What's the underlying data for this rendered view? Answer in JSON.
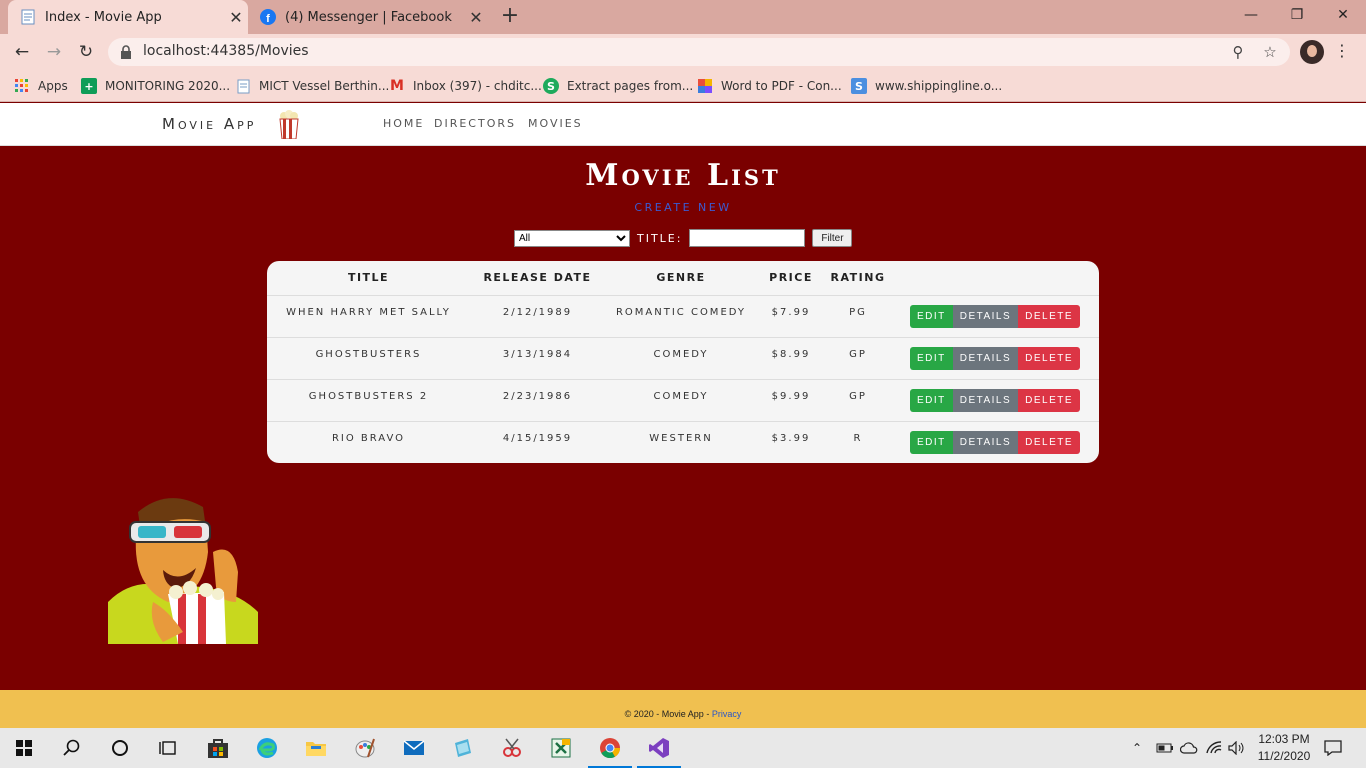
{
  "browser": {
    "tabs": [
      {
        "title": "Index - Movie App",
        "active": true,
        "icon": "page-icon"
      },
      {
        "title": "(4) Messenger | Facebook",
        "active": false,
        "icon": "facebook-icon"
      }
    ],
    "url": "localhost:44385/Movies",
    "bookmarks": [
      {
        "label": "Apps",
        "icon": "apps-grid-icon",
        "color": "#ea4335"
      },
      {
        "label": "MONITORING 2020...",
        "icon": "sheets-icon",
        "color": "#0f9d58"
      },
      {
        "label": "MICT Vessel Berthin...",
        "icon": "page-icon",
        "color": "#7a9cc6"
      },
      {
        "label": "Inbox (397) - chditc...",
        "icon": "gmail-icon",
        "color": "#d93025"
      },
      {
        "label": "Extract pages from...",
        "icon": "smallpdf-icon",
        "color": "#1eaa5c"
      },
      {
        "label": "Word to PDF - Con...",
        "icon": "ilovepdf-icon",
        "color": "#e94e3c"
      },
      {
        "label": "www.shippingline.o...",
        "icon": "s-site-icon",
        "color": "#4c8fe0"
      }
    ]
  },
  "site": {
    "brand": "Movie App",
    "nav": [
      "Home",
      "Directors",
      "Movies"
    ]
  },
  "main": {
    "title": "Movie List",
    "create_link": "Create New",
    "filter": {
      "genre_selected": "All",
      "title_label": "Title:",
      "title_value": "",
      "button": "Filter"
    },
    "columns": [
      "Title",
      "Release Date",
      "Genre",
      "Price",
      "Rating"
    ],
    "rows": [
      {
        "title": "When Harry Met Sally",
        "release": "2/12/1989",
        "genre": "Romantic Comedy",
        "price": "$7.99",
        "rating": "PG"
      },
      {
        "title": "Ghostbusters",
        "release": "3/13/1984",
        "genre": "Comedy",
        "price": "$8.99",
        "rating": "GP"
      },
      {
        "title": "Ghostbusters 2",
        "release": "2/23/1986",
        "genre": "Comedy",
        "price": "$9.99",
        "rating": "GP"
      },
      {
        "title": "Rio Bravo",
        "release": "4/15/1959",
        "genre": "Western",
        "price": "$3.99",
        "rating": "R"
      }
    ],
    "actions": {
      "edit": "Edit",
      "details": "Details",
      "delete": "Delete"
    }
  },
  "footer": {
    "text": "© 2020 - Movie App -",
    "privacy": "Privacy"
  },
  "taskbar": {
    "time": "12:03 PM",
    "date": "11/2/2020",
    "pinned": [
      "start-icon",
      "search-icon",
      "cortana-icon",
      "task-view-icon",
      "store-icon",
      "edge-icon",
      "file-explorer-icon",
      "paint-icon",
      "mail-icon",
      "app-icon",
      "snipping-icon",
      "excel-icon",
      "chrome-icon",
      "visual-studio-icon"
    ]
  },
  "colors": {
    "page_bg": "#7a0000",
    "footer_bg": "#f0c050",
    "edit": "#28a745",
    "details": "#6c757d",
    "delete": "#dc3545",
    "link": "#3c5ad0"
  }
}
